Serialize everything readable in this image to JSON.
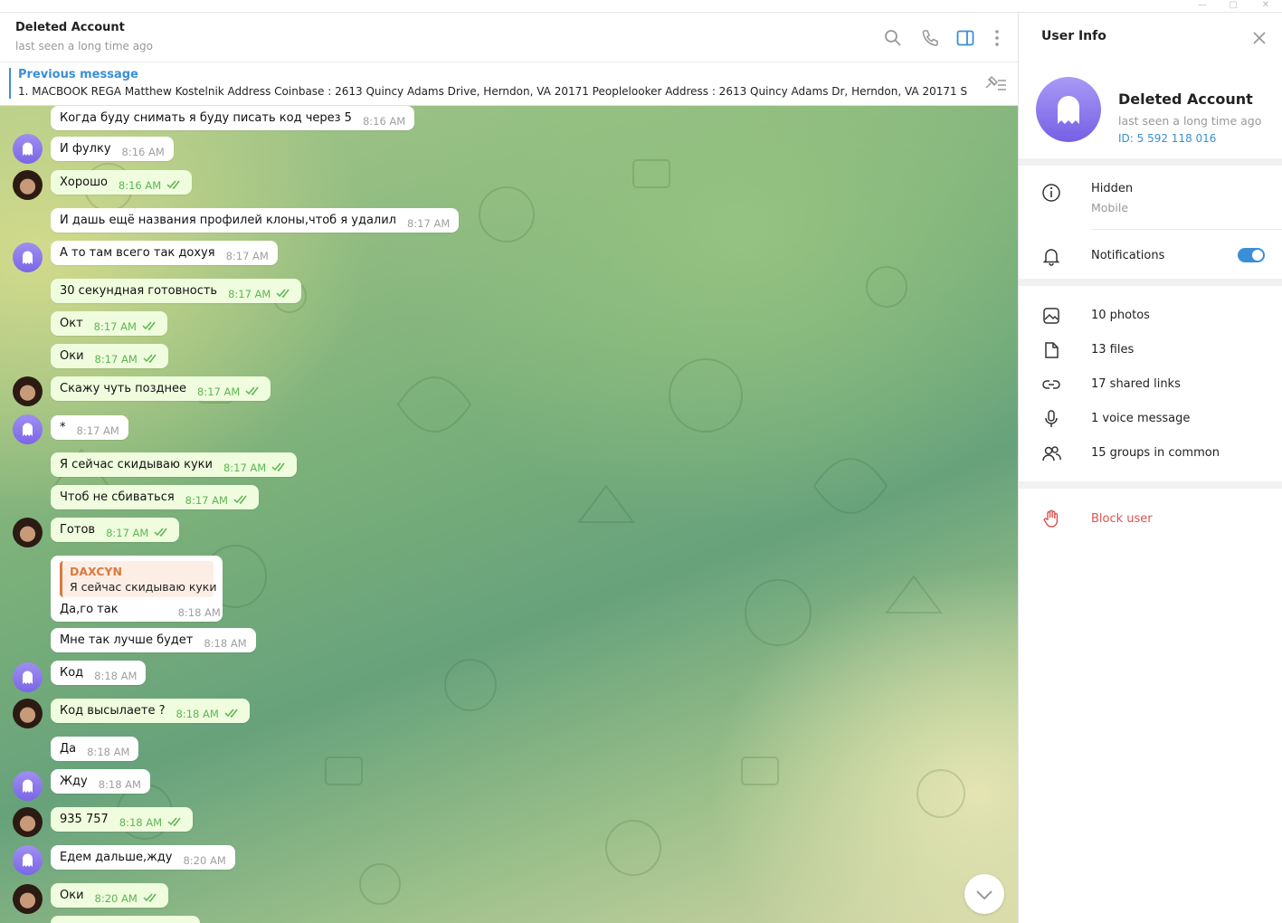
{
  "window": {
    "minimize": "—",
    "maximize": "▢",
    "close": "✕"
  },
  "chat": {
    "title": "Deleted Account",
    "status": "last seen a long time ago",
    "pinned_label": "Previous message",
    "pinned_text": "1. MACBOOK REGA  Matthew Kostelnik  Address Coinbase : 2613 Quincy Adams Drive, Herndon, VA 20171   Peoplelooker Address : 2613 Quincy Adams Dr, Herndon, VA 20171 S...",
    "messages": [
      {
        "text": "Когда буду снимать я буду писать код через 5",
        "time": "8:16 AM"
      },
      {
        "text": "И фулку",
        "time": "8:16 AM"
      },
      {
        "text": "Хорошо",
        "time": "8:16 AM"
      },
      {
        "text": "И дашь ещё названия профилей клоны,чтоб я удалил",
        "time": "8:17 AM"
      },
      {
        "text": "А то там всего так дохуя",
        "time": "8:17 AM"
      },
      {
        "text": "30 секундная готовность",
        "time": "8:17 AM"
      },
      {
        "text": "Окт",
        "time": "8:17 AM"
      },
      {
        "text": "Оки",
        "time": "8:17 AM"
      },
      {
        "text": "Скажу чуть позднее",
        "time": "8:17 AM"
      },
      {
        "text": "*",
        "time": "8:17 AM"
      },
      {
        "text": "Я сейчас скидываю куки",
        "time": "8:17 AM"
      },
      {
        "text": "Чтоб не сбиваться",
        "time": "8:17 AM"
      },
      {
        "text": "Готов",
        "time": "8:17 AM"
      },
      {
        "reply_name": "DAXCYN",
        "reply_text": "Я сейчас скидываю куки",
        "text": "Да,го так",
        "time": "8:18 AM"
      },
      {
        "text": "Мне так лучше будет",
        "time": "8:18 AM"
      },
      {
        "text": "Код",
        "time": "8:18 AM"
      },
      {
        "text": "Код высылаете ?",
        "time": "8:18 AM"
      },
      {
        "text": "Да",
        "time": "8:18 AM"
      },
      {
        "text": "Жду",
        "time": "8:18 AM"
      },
      {
        "text": "935 757",
        "time": "8:18 AM"
      },
      {
        "text": "Едем дальше,жду",
        "time": "8:20 AM"
      },
      {
        "text": "Оки",
        "time": "8:20 AM"
      }
    ]
  },
  "info": {
    "title": "User Info",
    "name": "Deleted Account",
    "seen": "last seen a long time ago",
    "id": "ID: 5 592 118 016",
    "phone": "Hidden",
    "phone_sub": "Mobile",
    "notifications": "Notifications",
    "photos": "10 photos",
    "files": "13 files",
    "links": "17 shared links",
    "voice": "1 voice message",
    "groups": "15 groups in common",
    "block": "Block user"
  },
  "colors": {
    "accent": "#3a8fd6",
    "outgoing": "#effdde",
    "danger": "#d9534f",
    "avatar": "#8a78ec"
  }
}
